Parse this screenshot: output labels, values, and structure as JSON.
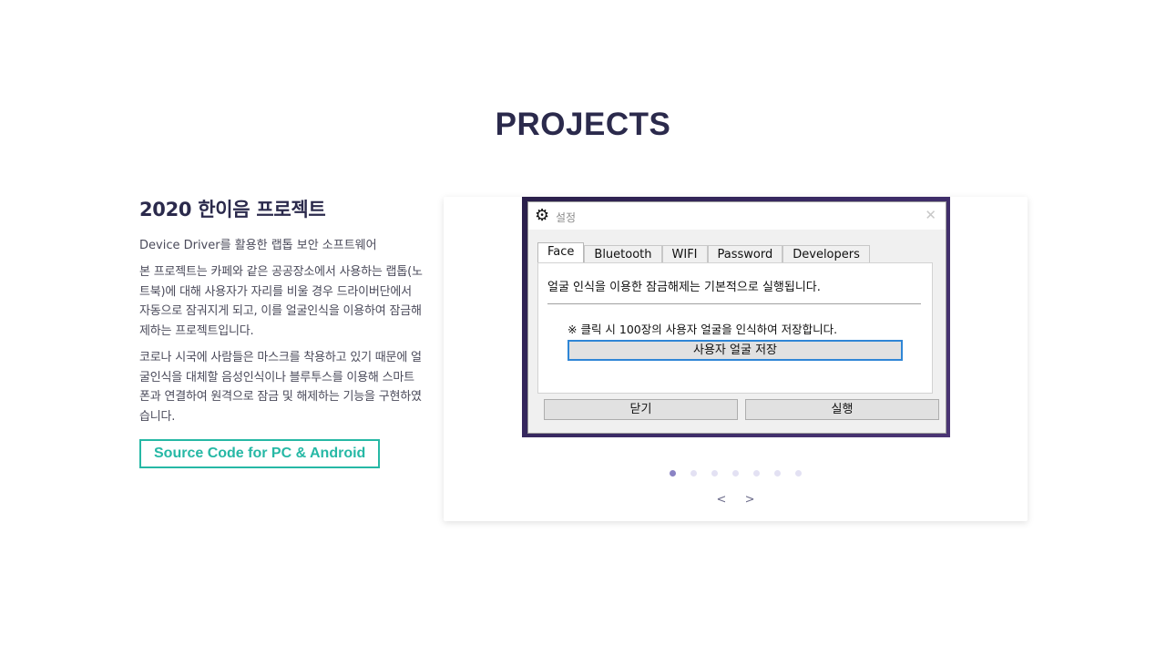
{
  "section": {
    "title": "PROJECTS"
  },
  "project": {
    "title": "2020 한이음 프로젝트",
    "subtitle": "Device Driver를 활용한 랩톱 보안 소프트웨어",
    "desc1": "본 프로젝트는 카페와 같은 공공장소에서 사용하는 랩톱(노트북)에 대해 사용자가 자리를 비울 경우 드라이버단에서 자동으로 잠궈지게 되고, 이를 얼굴인식을 이용하여 잠금해제하는 프로젝트입니다.",
    "desc2": "코로나 시국에 사람들은 마스크를 착용하고 있기 때문에 얼굴인식을 대체할 음성인식이나 블루투스를 이용해 스마트폰과 연결하여 원격으로 잠금 및 해제하는 기능을 구현하였습니다.",
    "source_button": "Source Code for PC & Android"
  },
  "screenshot": {
    "window_title": "설정",
    "close_glyph": "✕",
    "gear_glyph": "⚙",
    "tabs": [
      "Face",
      "Bluetooth",
      "WIFI",
      "Password",
      "Developers"
    ],
    "panel_text": "얼굴 인식을 이용한 잠금해제는 기본적으로 실행됩니다.",
    "note": "※ 클릭 시 100장의 사용자 얼굴을 인식하여 저장합니다.",
    "save_button": "사용자 얼굴 저장",
    "close_button": "닫기",
    "run_button": "실행"
  },
  "carousel": {
    "dots": 7,
    "active_dot": 0,
    "prev": "<",
    "next": ">"
  },
  "colors": {
    "title": "#2b2a4c",
    "accent": "#26b8a5",
    "dot_active": "#8a83c4",
    "dot_inactive": "#e3e1f3"
  }
}
